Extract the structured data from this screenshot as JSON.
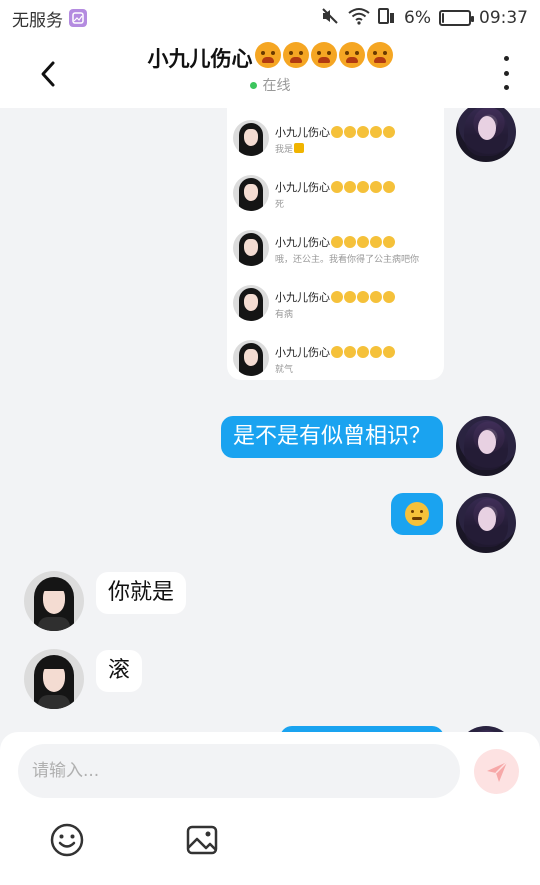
{
  "status_bar": {
    "carrier": "无服务",
    "battery": "6%",
    "battery_level": 0.06,
    "time": "09:37"
  },
  "header": {
    "contact_name": "小九儿伤心",
    "title_emoji_count": 5,
    "presence": "在线",
    "accent_color": "#3cc55d"
  },
  "forwarded_card": {
    "items": [
      {
        "name": "小九儿伤心",
        "message": "我是"
      },
      {
        "name": "小九儿伤心",
        "message": "死"
      },
      {
        "name": "小九儿伤心",
        "message": "哦，还公主。我看你得了公主病吧你"
      },
      {
        "name": "小九儿伤心",
        "message": "有病"
      },
      {
        "name": "小九儿伤心",
        "message": "就气"
      }
    ]
  },
  "messages": [
    {
      "side": "out",
      "text": "是不是有似曾相识？"
    },
    {
      "side": "out",
      "type": "emoji",
      "icon": "frowning-face"
    },
    {
      "side": "in",
      "text": "你就是"
    },
    {
      "side": "in",
      "text": "滚"
    }
  ],
  "input": {
    "placeholder": "请输入...",
    "value": ""
  },
  "colors": {
    "outgoing_bubble": "#1aa3f0",
    "incoming_bubble": "#ffffff",
    "background": "#f2f3f5",
    "send_button": "#fde2e2"
  }
}
